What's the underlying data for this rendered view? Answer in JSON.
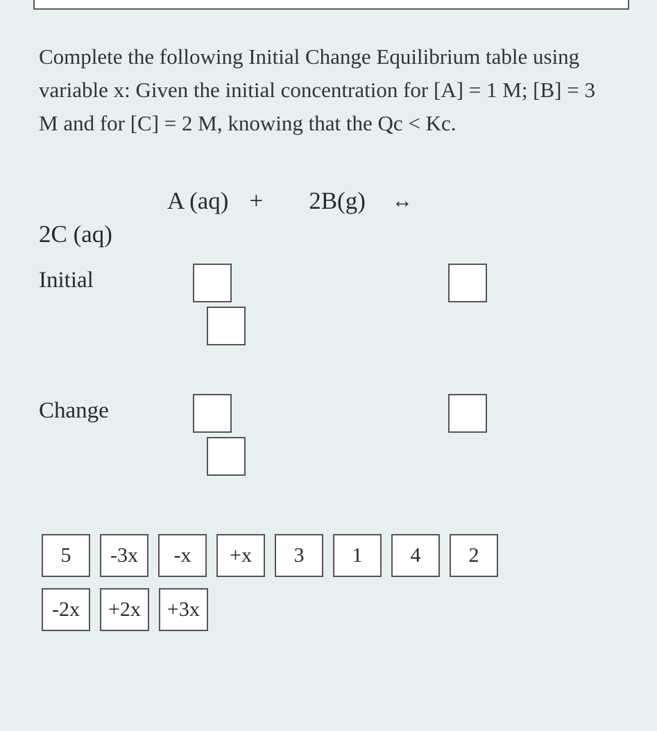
{
  "question": "Complete the following Initial Change Equilibrium table using variable x: Given the initial concentration for [A] = 1 M; [B] = 3 M and for [C] = 2 M, knowing that the Qc < Kc.",
  "equation": {
    "term_a": "A (aq)",
    "plus": "+",
    "term_b": "2B(g)",
    "arrow": "↔",
    "term_c": "2C (aq)"
  },
  "rows": {
    "initial": "Initial",
    "change": "Change"
  },
  "bank": {
    "row1": [
      "5",
      "-3x",
      "-x",
      "+x",
      "3",
      "1",
      "4",
      "2"
    ],
    "row2": [
      "-2x",
      "+2x",
      "+3x"
    ]
  }
}
